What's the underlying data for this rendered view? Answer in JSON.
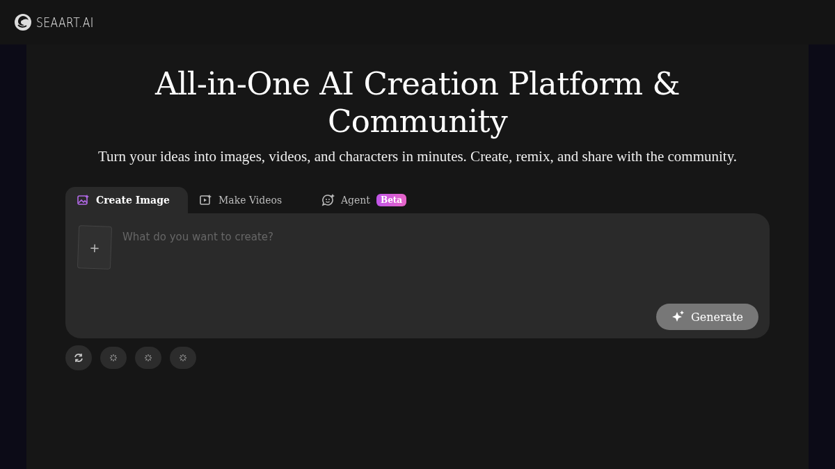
{
  "header": {
    "logo": "SEAART.AI"
  },
  "hero": {
    "title": "All-in-One AI Creation Platform & Community",
    "subtitle": "Turn your ideas into images, videos, and characters in minutes. Create, remix, and share with the community."
  },
  "tabs": [
    {
      "label": "Create Image",
      "kind": "image",
      "selected": true
    },
    {
      "label": "Make Videos",
      "kind": "video",
      "selected": false
    },
    {
      "label": "Agent",
      "kind": "agent",
      "selected": false,
      "badge": "Beta"
    }
  ],
  "composer": {
    "add_label": "+",
    "placeholder": "What do you want to create?",
    "button": "Generate"
  },
  "chips": [
    {
      "kind": "refresh"
    },
    {
      "kind": "loading"
    },
    {
      "kind": "loading"
    },
    {
      "kind": "loading"
    }
  ]
}
